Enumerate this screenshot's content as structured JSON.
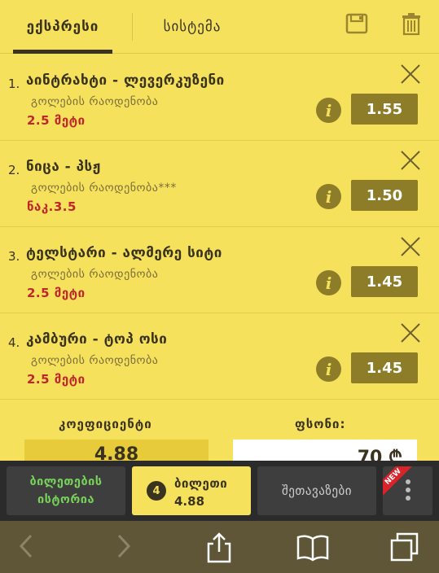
{
  "tabs": {
    "express": "ექსპრესი",
    "system": "სისტემა"
  },
  "icons": {
    "save": "save-icon",
    "trash": "trash-icon",
    "close": "close-icon",
    "info": "info-icon"
  },
  "bets": [
    {
      "number": "1.",
      "title": "აინტრახტი - ლევერკუზენი",
      "market": "გოლების რაოდენობა",
      "pick": "2.5 მეტი",
      "odds": "1.55",
      "info": "i"
    },
    {
      "number": "2.",
      "title": "ნიცა - პსჟ",
      "market": "გოლების რაოდენობა***",
      "pick": "ნაკ.3.5",
      "odds": "1.50",
      "info": "i"
    },
    {
      "number": "3.",
      "title": "ტელსტარი - ალმერე სიტი",
      "market": "გოლების რაოდენობა",
      "pick": "2.5 მეტი",
      "odds": "1.45",
      "info": "i"
    },
    {
      "number": "4.",
      "title": "კამბური - ტოპ ოსი",
      "market": "გოლების რაოდენობა",
      "pick": "2.5 მეტი",
      "odds": "1.45",
      "info": "i"
    }
  ],
  "summary": {
    "coef_label": "კოეფიციენტი",
    "coef_value": "4.88",
    "stake_label": "ფსონი:",
    "stake_value": "70 ₾"
  },
  "bottom_nav": {
    "history_line1": "ბილეთების",
    "history_line2": "ისტორია",
    "ticket_count": "4",
    "ticket_label": "ბილეთი",
    "ticket_odds": "4.88",
    "promo_label": "შეთავაზები",
    "new_badge": "NEW"
  },
  "colors": {
    "background": "#f5e15c",
    "odds_button": "#8e7d28",
    "pick_red": "#c0272d",
    "history_green": "#77d15a",
    "nav_dark": "#2b2b2b"
  }
}
